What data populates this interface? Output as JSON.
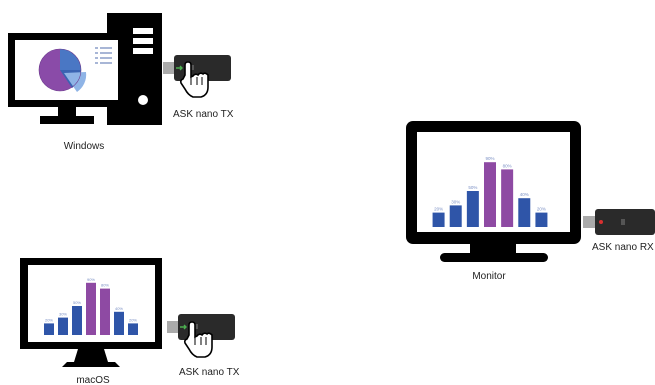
{
  "labels": {
    "windows": "Windows",
    "macos": "macOS",
    "monitor": "Monitor",
    "tx_windows": "ASK nano TX",
    "tx_macos": "ASK nano TX",
    "rx": "ASK nano RX"
  },
  "screen_chart": {
    "values": [
      20,
      30,
      50,
      90,
      80,
      40,
      20
    ],
    "value_labels": [
      "20%",
      "30%",
      "50%",
      "90%",
      "80%",
      "40%",
      "20%"
    ],
    "highlight_indices": [
      3,
      4
    ],
    "bar_color": "#2f55a8",
    "highlight_color": "#8e4aa3",
    "label_color": "#7a8fc4"
  },
  "colors": {
    "device_body": "#000000",
    "dongle_body": "#2a2a2a",
    "tx_led": "#4caf50",
    "rx_led": "#d93030",
    "usb_plug": "#aaaaaa",
    "pie_blue": "#4a77c4",
    "pie_purple": "#8a4ba8",
    "pie_light": "#8fb4e6"
  },
  "icons": {
    "pointer": "hand-pointer-icon"
  }
}
